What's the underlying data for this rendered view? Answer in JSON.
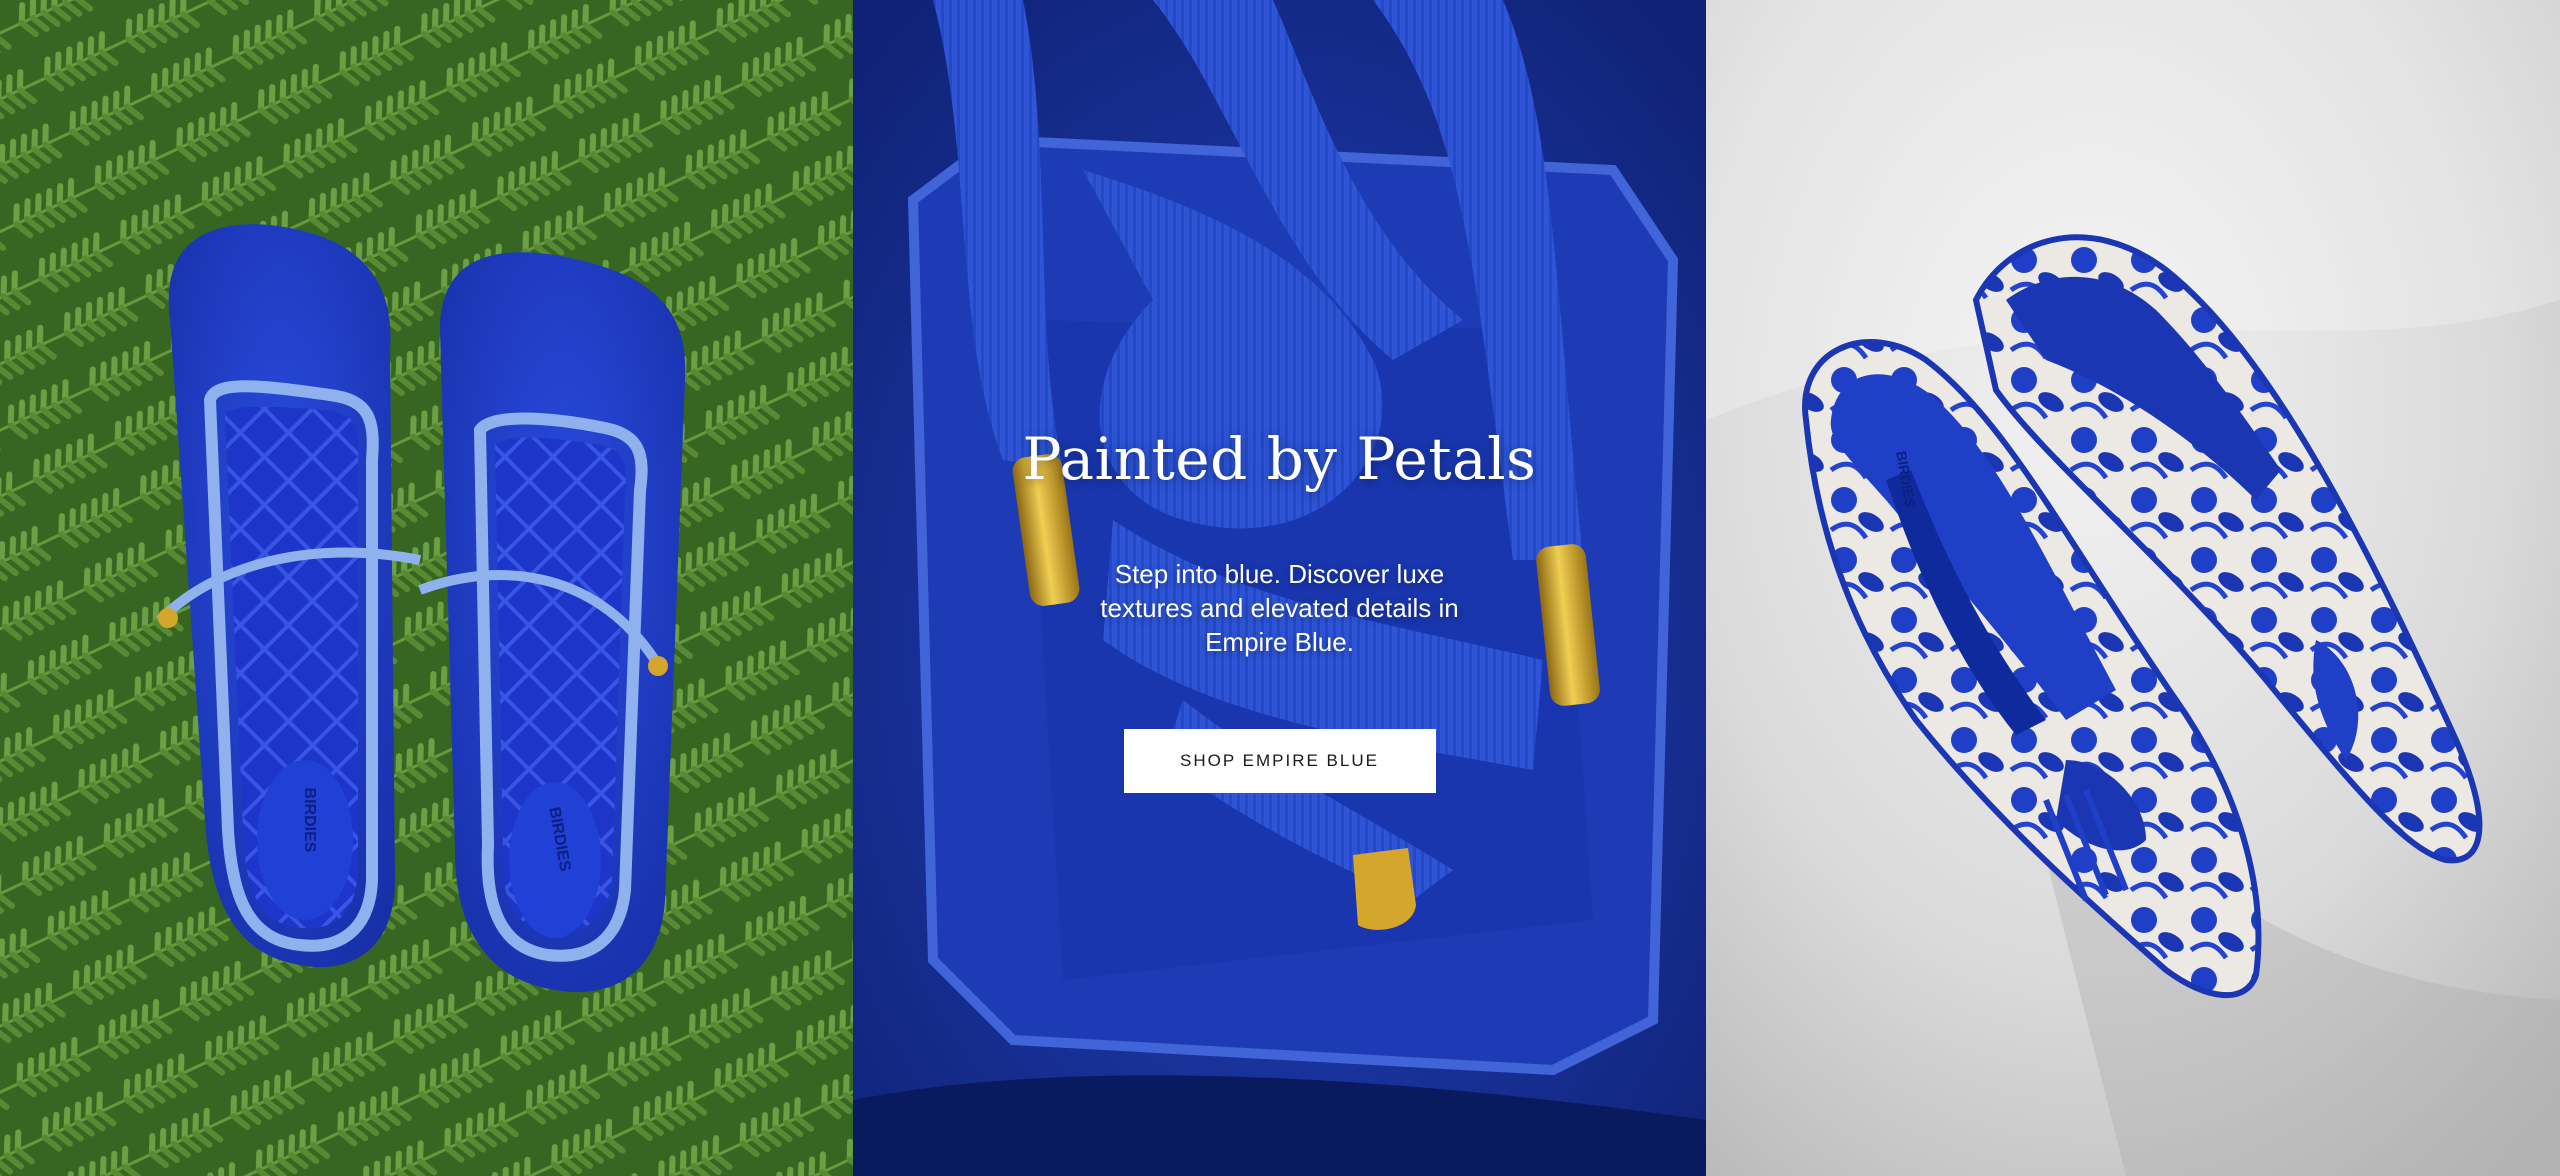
{
  "hero": {
    "headline": "Painted by Petals",
    "subtext": "Step into blue. Discover luxe textures and elevated details in Empire Blue.",
    "cta_label": "SHOP EMPIRE BLUE"
  },
  "panels": [
    {
      "name": "blue-suede-mary-jane-flats-on-ferns",
      "insole_brand": "BIRDIES"
    },
    {
      "name": "blue-velvet-bag-with-grosgrain-ribbons"
    },
    {
      "name": "blue-embroidered-tassel-loafers-on-marble",
      "insole_brand": "BIRDIES"
    }
  ],
  "colors": {
    "empire_blue": "#1f3fb8",
    "fern_green": "#4f8a2e",
    "marble": "#e6e6e6",
    "gold": "#d4a72c",
    "cta_background": "#ffffff",
    "cta_text": "#1a1a1a"
  }
}
